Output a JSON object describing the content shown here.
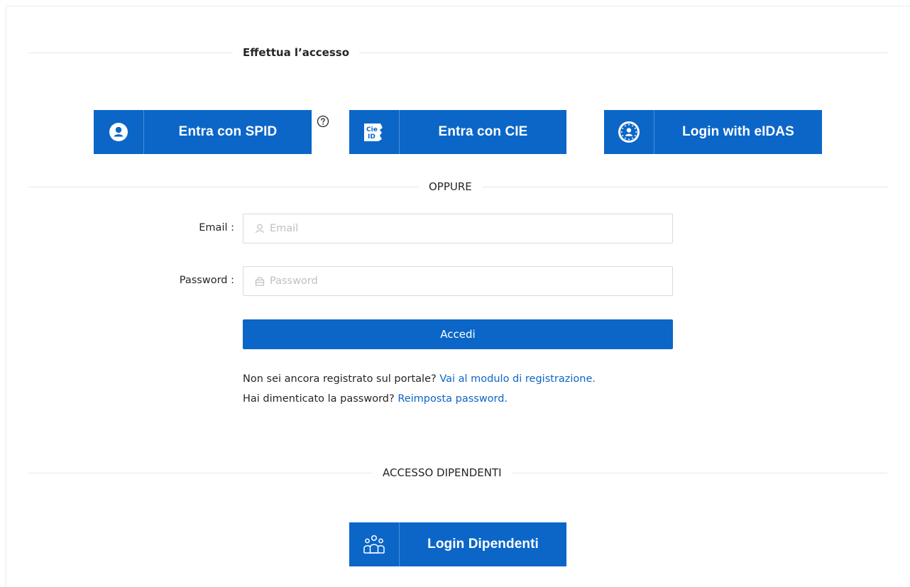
{
  "sections": {
    "login_title": "Effettua l’accesso",
    "or_title": "OPPURE",
    "employees_title": "ACCESSO DIPENDENTI"
  },
  "auth": {
    "spid_label": "Entra con SPID",
    "cie_label": "Entra con CIE",
    "cie_logo_text": "Cie ID",
    "eidas_label": "Login with eIDAS"
  },
  "form": {
    "email_label": "Email",
    "email_placeholder": "Email",
    "email_value": "",
    "password_label": "Password",
    "password_placeholder": "Password",
    "password_value": "",
    "submit_label": "Accedi"
  },
  "help": {
    "register_question": "Non sei ancora registrato sul portale?",
    "register_link": "Vai al modulo di registrazione.",
    "forgot_question": "Hai dimenticato la password?",
    "forgot_link": "Reimposta password."
  },
  "employees": {
    "login_label": "Login Dipendenti"
  },
  "colors": {
    "primary": "#0b66c8",
    "link": "#0b66c8",
    "divider": "#e6e6e6",
    "text": "#262626"
  }
}
